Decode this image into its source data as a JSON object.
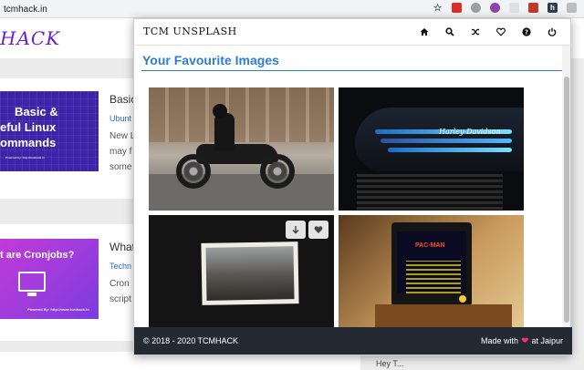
{
  "browser": {
    "url": "tcmhack.in",
    "extensions": [
      {
        "icon": "star-icon",
        "color": "#5f6368"
      },
      {
        "icon": "ext-red-icon",
        "color": "#d93025"
      },
      {
        "icon": "ext-grey-icon",
        "color": "#9aa0a6"
      },
      {
        "icon": "ext-purple-icon",
        "color": "#8e44ad"
      },
      {
        "icon": "ext-shield-icon",
        "color": "#5f6368"
      },
      {
        "icon": "ext-red-square-icon",
        "color": "#c0392b"
      },
      {
        "icon": "ext-h-icon",
        "color": "#2c3e50"
      },
      {
        "icon": "ext-grey-square-icon",
        "color": "#bdbdbd"
      }
    ]
  },
  "background_page": {
    "logo": "HACK",
    "posts": [
      {
        "title": "Basic",
        "category": "Ubunt",
        "lines": [
          "New L",
          "may f",
          "some"
        ],
        "thumb_text": [
          "Basic &",
          "eful Linux",
          "ommands"
        ],
        "thumb_small": "Powered by: http://tcmhack.in"
      },
      {
        "title": "What",
        "category": "Techn",
        "lines": [
          "Cron",
          "script"
        ],
        "thumb_text": [
          "t are Cronjobs?"
        ],
        "thumb_small": "Powered By: http://www.tcmhack.in"
      }
    ],
    "right_text": "Hey T..."
  },
  "popup": {
    "brand": "TCM UNSPLASH",
    "nav_icons": [
      "home-icon",
      "search-icon",
      "shuffle-icon",
      "heart-icon",
      "help-icon",
      "power-icon"
    ],
    "heading": "Your Favourite Images",
    "tank_logo": "Harley-Davidson",
    "arcade_text": "PAC-MAN",
    "footer": {
      "copyright": "2018 - 2020 TCMHACK",
      "made_with": "Made with",
      "location": "at Jaipur"
    },
    "colors": {
      "heading": "#2f7cd8",
      "footer_bg": "#232a34",
      "heart": "#ff2a86"
    }
  }
}
